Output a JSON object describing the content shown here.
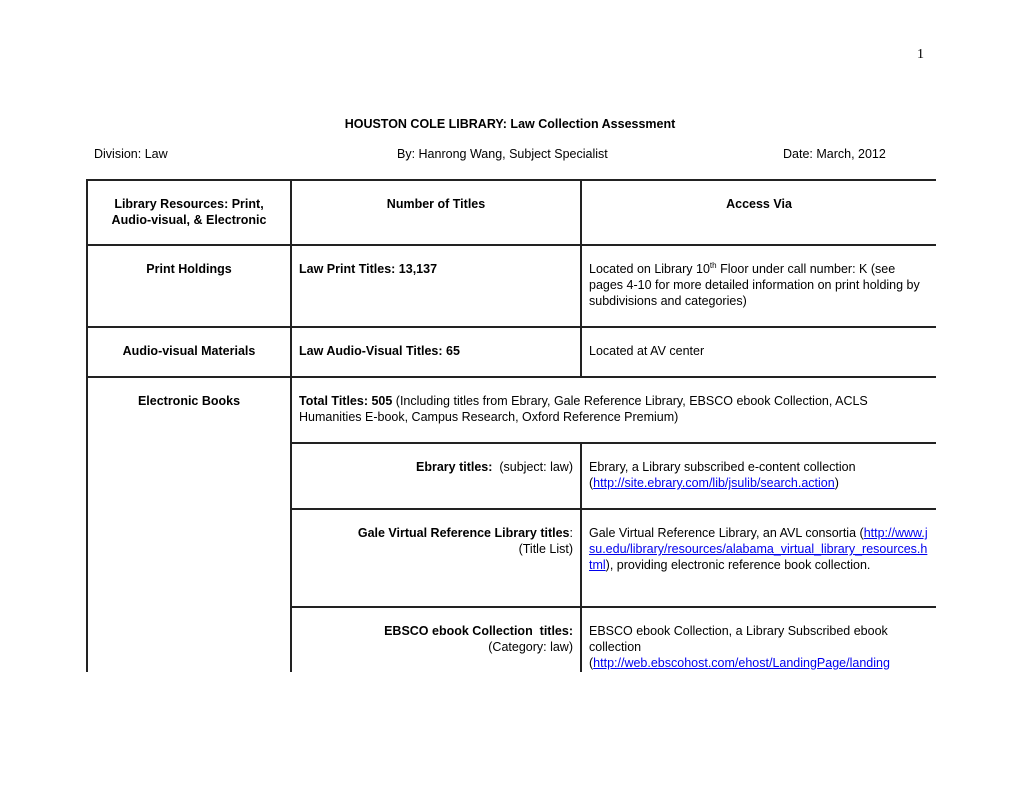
{
  "page_number": "1",
  "header": {
    "title": "HOUSTON COLE LIBRARY: Law Collection Assessment",
    "division": "Division: Law",
    "author": "By: Hanrong Wang, Subject Specialist",
    "date": "Date: March, 2012"
  },
  "table": {
    "columns": [
      "Library Resources: Print, Audio-visual, & Electronic",
      "Number of Titles",
      "Access Via"
    ],
    "rows": {
      "print": {
        "resource": "Print Holdings",
        "titles": "Law Print Titles: 13,137",
        "access_pre": "Located on Library 10",
        "access_sup": "th",
        "access_post": " Floor under call number: K (see pages 4-10 for more detailed information on print holding by subdivisions and categories)"
      },
      "av": {
        "resource": "Audio-visual Materials",
        "titles": "Law Audio-Visual Titles: 65",
        "access": "Located at AV center"
      },
      "ebooks": {
        "resource": "Electronic Books",
        "total_label": "Total Titles: 505",
        "total_note": " (Including titles from Ebrary, Gale Reference Library, EBSCO ebook Collection, ACLS Humanities E-book, Campus Research, Oxford Reference Premium)",
        "sub": [
          {
            "label": "Ebrary titles:",
            "qualifier": "  (subject: law)",
            "access_pre": "Ebrary, a Library subscribed e-content collection (",
            "link": "http://site.ebrary.com/lib/jsulib/search.action",
            "access_post": ")"
          },
          {
            "label": "Gale Virtual Reference Library titles",
            "label_suffix": ":",
            "qualifier": "(Title List)",
            "access_pre": "Gale Virtual Reference Library, an AVL consortia (",
            "link": "http://www.jsu.edu/library/resources/alabama_virtual_library_resources.html",
            "access_post": "), providing electronic reference book collection."
          },
          {
            "label": "EBSCO ebook Collection  titles:",
            "qualifier": "(Category: law)",
            "access_pre": "EBSCO ebook Collection, a Library Subscribed ebook collection (",
            "link": "http://web.ebscohost.com/ehost/LandingPage/landing",
            "access_post": ""
          }
        ]
      }
    }
  },
  "colors": {
    "link": "#0000ee",
    "border": "#222222"
  }
}
